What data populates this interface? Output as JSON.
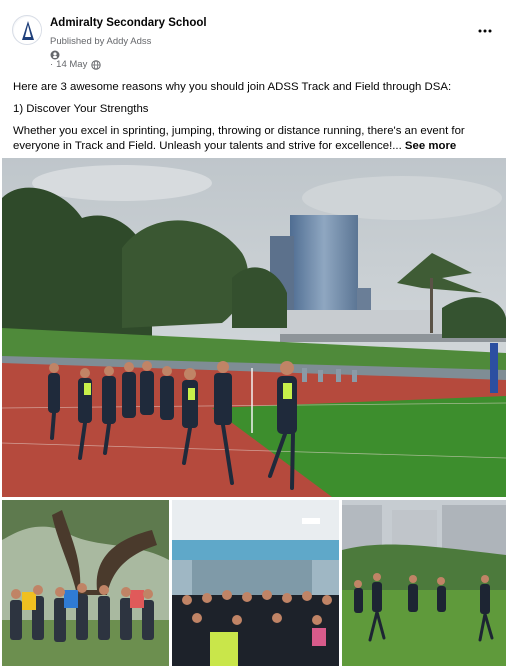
{
  "post": {
    "page_name": "Admiralty Secondary School",
    "published_by": "Published by Addy Adss",
    "date": "14 May",
    "date_separator": "·",
    "body": {
      "intro": "Here are 3 awesome reasons why you should join ADSS Track and Field through DSA:",
      "point_1": "1) Discover Your Strengths",
      "paragraph": "Whether you excel in sprinting, jumping, throwing or distance running, there's an event for everyone in Track and Field. Unleash your talents and strive for excellence!...",
      "see_more": "See more"
    }
  },
  "icons": {
    "avatar": "school-crest-icon",
    "badge": "info-badge-icon",
    "audience": "globe-icon",
    "menu": "more-horizontal-icon"
  },
  "colors": {
    "text_primary": "#050505",
    "text_secondary": "#65676b",
    "track": "#b94a3f",
    "field": "#3f8f2e",
    "sky": "#c9cfd3"
  }
}
